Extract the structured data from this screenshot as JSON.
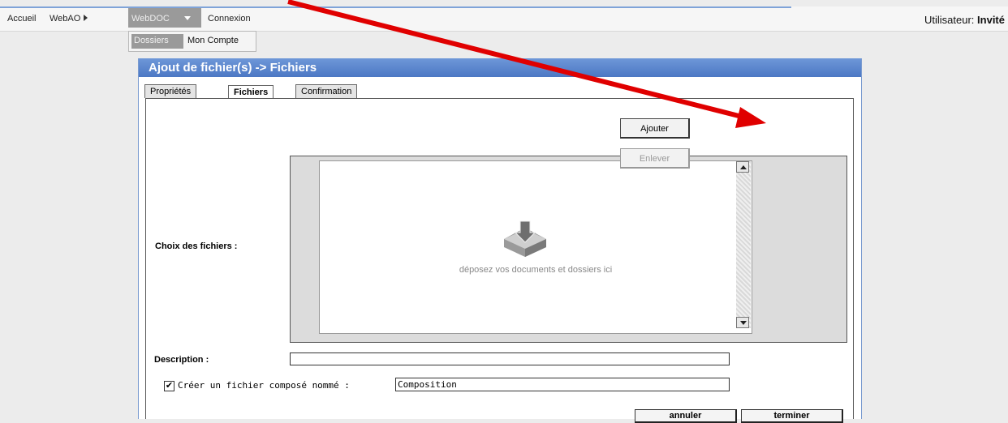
{
  "nav": {
    "items": [
      "Accueil",
      "WebAO",
      "WebDOC",
      "Connexion"
    ],
    "user_prefix": "Utilisateur: ",
    "user_name": "Invité"
  },
  "submenu": {
    "items": [
      "Dossiers",
      "Mon Compte"
    ]
  },
  "panel": {
    "title": "Ajout de fichier(s) -> Fichiers",
    "tabs": [
      "Propriétés",
      "Fichiers",
      "Confirmation"
    ],
    "active_tab": "Fichiers"
  },
  "form": {
    "choix_label": "Choix des fichiers :",
    "drop_text": "déposez vos documents et dossiers ici",
    "add_button": "Ajouter",
    "remove_button": "Enlever",
    "description_label": "Description :",
    "description_value": "",
    "compose_checked": true,
    "compose_label": "Créer un fichier composé nommé :",
    "compose_value": "Composition",
    "cancel_button": "annuler",
    "finish_button": "terminer"
  },
  "colors": {
    "header_blue": "#5a86cd",
    "annotation_arrow": "#e00000"
  }
}
